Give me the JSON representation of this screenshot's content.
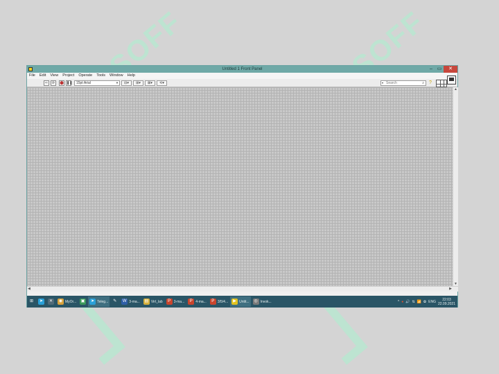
{
  "window": {
    "title": "Untitled 1 Front Panel",
    "controls": {
      "minimize": "–",
      "maximize": "▭",
      "close": "✕"
    }
  },
  "menubar": [
    "File",
    "Edit",
    "View",
    "Project",
    "Operate",
    "Tools",
    "Window",
    "Help"
  ],
  "toolbar": {
    "buttons": [
      {
        "name": "run-arrow-icon",
        "glyph": "⇨"
      },
      {
        "name": "run-continuously-icon",
        "glyph": "⟳"
      },
      {
        "name": "abort-icon",
        "glyph": "⬤"
      },
      {
        "name": "pause-icon",
        "glyph": "❚❚"
      }
    ],
    "font": "15pt Arial",
    "dropdowns": [
      {
        "name": "align-objects-dropdown",
        "glyph": "⊟▾"
      },
      {
        "name": "distribute-objects-dropdown",
        "glyph": "⊞▾"
      },
      {
        "name": "resize-objects-dropdown",
        "glyph": "⊠▾"
      },
      {
        "name": "reorder-dropdown",
        "glyph": "⟲▾"
      }
    ],
    "search_placeholder": "Search",
    "help_glyph": "?"
  },
  "taskbar": {
    "items": [
      {
        "name": "start-icon",
        "label": "",
        "glyph": "⊞",
        "color": "#2a5566"
      },
      {
        "name": "telegram-icon",
        "label": "",
        "glyph": "➤",
        "color": "#2aa0d8"
      },
      {
        "name": "app-icon-x",
        "label": "",
        "glyph": "✕",
        "color": "#506a78"
      },
      {
        "name": "chrome-icon",
        "label": "MyOr...",
        "glyph": "◉",
        "color": "#d9a23c"
      },
      {
        "name": "store-icon",
        "label": "",
        "glyph": "▣",
        "color": "#3a9a5a"
      },
      {
        "name": "telegram-window-icon",
        "label": "Teleg...",
        "glyph": "➤",
        "color": "#2aa0d8",
        "active": true
      },
      {
        "name": "pen-icon",
        "label": "",
        "glyph": "✎",
        "color": "#2a5566"
      },
      {
        "name": "word-icon",
        "label": "3-ma...",
        "glyph": "W",
        "color": "#2f5fa8"
      },
      {
        "name": "folder-icon",
        "label": "Virt_lab",
        "glyph": "▤",
        "color": "#d6b03c"
      },
      {
        "name": "powerpoint-icon-1",
        "label": "3-ma...",
        "glyph": "P",
        "color": "#c9452d"
      },
      {
        "name": "powerpoint-icon-2",
        "label": "4-ma...",
        "glyph": "P",
        "color": "#c9452d"
      },
      {
        "name": "powerpoint-icon-3",
        "label": "3/5/4...",
        "glyph": "P",
        "color": "#c9452d"
      },
      {
        "name": "labview-icon",
        "label": "Untit...",
        "glyph": "▶",
        "color": "#e2c21e",
        "active": true
      },
      {
        "name": "search-app-icon",
        "label": "Invok...",
        "glyph": "◎",
        "color": "#7a7a7a"
      }
    ],
    "tray": {
      "icons": [
        "^",
        "●",
        "🔊",
        "⇅",
        "📶",
        "✿"
      ],
      "language": "ENG",
      "time": "22:03",
      "date": "22.09.2021"
    }
  },
  "watermark": "SOFF"
}
